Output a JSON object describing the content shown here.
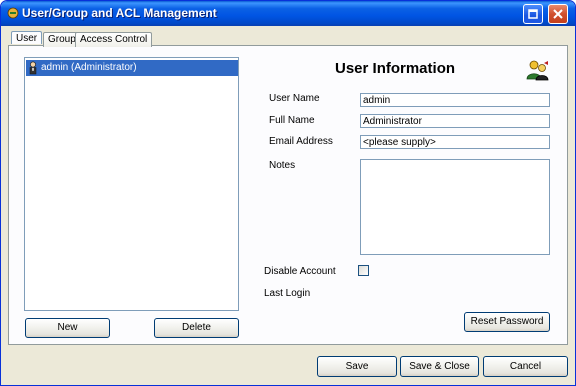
{
  "window": {
    "title": "User/Group and ACL Management"
  },
  "tabs": [
    {
      "label": "User",
      "selected": true
    },
    {
      "label": "Group",
      "selected": false
    },
    {
      "label": "Access Control",
      "selected": false
    }
  ],
  "user_list": {
    "items": [
      {
        "label": "admin (Administrator)",
        "selected": true,
        "icon": "user-icon"
      }
    ],
    "new_label": "New",
    "delete_label": "Delete"
  },
  "user_info": {
    "heading": "User Information",
    "icon": "users-icon",
    "username_label": "User Name",
    "username_value": "admin",
    "fullname_label": "Full Name",
    "fullname_value": "Administrator",
    "email_label": "Email Address",
    "email_value": "<please supply>",
    "notes_label": "Notes",
    "notes_value": "",
    "disable_label": "Disable Account",
    "disable_checked": false,
    "lastlogin_label": "Last Login",
    "reset_password_label": "Reset Password"
  },
  "footer": {
    "save_label": "Save",
    "save_close_label": "Save & Close",
    "cancel_label": "Cancel"
  },
  "colors": {
    "titlebar": "#0054e3",
    "selection": "#316ac5",
    "window_bg": "#ece9d8"
  }
}
